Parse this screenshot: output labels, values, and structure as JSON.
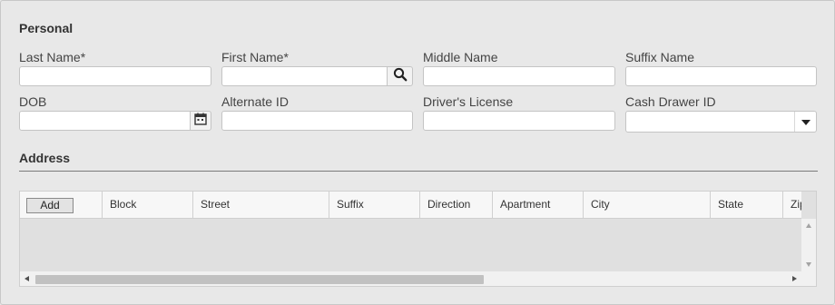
{
  "personal": {
    "title": "Personal",
    "fields": {
      "last_name": {
        "label": "Last Name*",
        "value": ""
      },
      "first_name": {
        "label": "First Name*",
        "value": ""
      },
      "middle_name": {
        "label": "Middle Name",
        "value": ""
      },
      "suffix_name": {
        "label": "Suffix Name",
        "value": ""
      },
      "dob": {
        "label": "DOB",
        "value": ""
      },
      "alternate_id": {
        "label": "Alternate ID",
        "value": ""
      },
      "drivers_license": {
        "label": "Driver's License",
        "value": ""
      },
      "cash_drawer_id": {
        "label": "Cash Drawer ID",
        "value": ""
      }
    },
    "icons": {
      "search": "search-icon",
      "calendar": "calendar-icon",
      "dropdown": "chevron-down-icon"
    }
  },
  "address": {
    "title": "Address",
    "add_label": "Add",
    "columns": [
      "Block",
      "Street",
      "Suffix",
      "Direction",
      "Apartment",
      "City",
      "State",
      "Zip"
    ],
    "rows": []
  },
  "colors": {
    "panel_bg": "#e8e8e8",
    "input_border": "#c4c4c4",
    "grid_header_bg": "#f7f7f7",
    "grid_body_bg": "#e0e0e0"
  }
}
